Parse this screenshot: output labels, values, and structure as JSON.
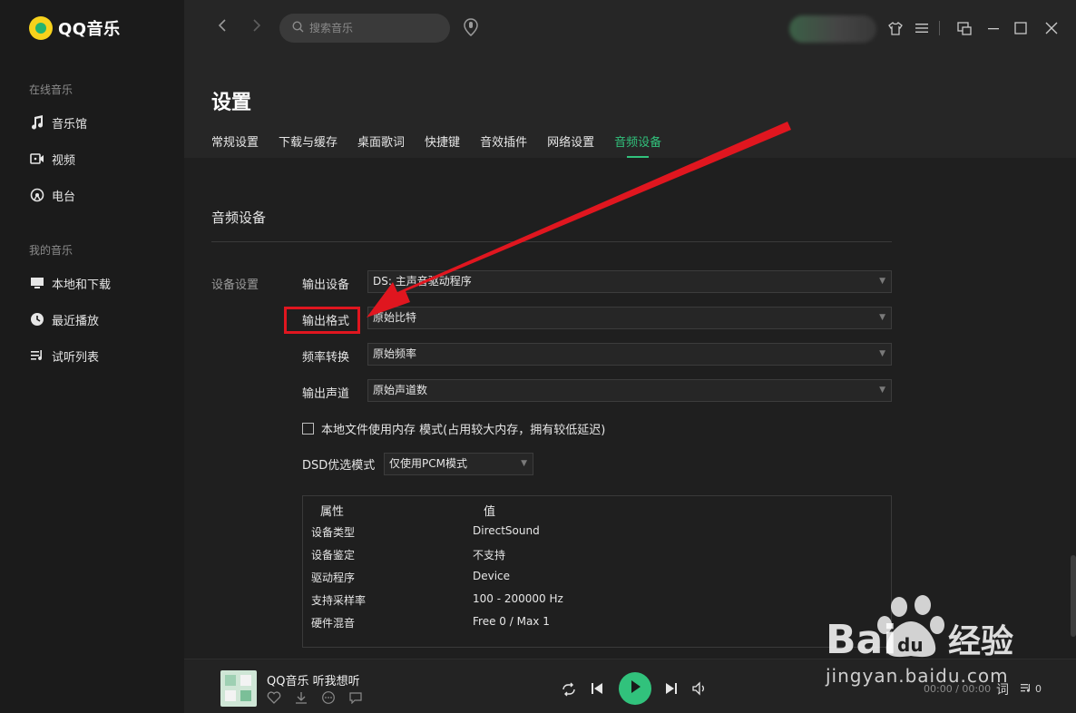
{
  "app": {
    "name": "QQ音乐"
  },
  "sidebar": {
    "group_online": "在线音乐",
    "online_items": [
      {
        "label": "音乐馆",
        "icon": "music-note-icon"
      },
      {
        "label": "视频",
        "icon": "video-icon"
      },
      {
        "label": "电台",
        "icon": "radio-icon"
      }
    ],
    "group_mine": "我的音乐",
    "mine_items": [
      {
        "label": "本地和下载",
        "icon": "computer-icon"
      },
      {
        "label": "最近播放",
        "icon": "clock-icon"
      },
      {
        "label": "试听列表",
        "icon": "playlist-icon"
      }
    ]
  },
  "topbar": {
    "search_placeholder": "搜索音乐"
  },
  "settings": {
    "title": "设置",
    "tabs": [
      "常规设置",
      "下载与缓存",
      "桌面歌词",
      "快捷键",
      "音效插件",
      "网络设置",
      "音频设备"
    ],
    "active_tab": "音频设备",
    "section_title": "音频设备",
    "group_label": "设备设置",
    "rows": [
      {
        "label": "输出设备",
        "value": "DS: 主声音驱动程序"
      },
      {
        "label": "输出格式",
        "value": "原始比特"
      },
      {
        "label": "频率转换",
        "value": "原始频率"
      },
      {
        "label": "输出声道",
        "value": "原始声道数"
      }
    ],
    "memory_mode_label": "本地文件使用内存 模式(占用较大内存，拥有较低延迟)",
    "memory_mode_checked": false,
    "dsd_label": "DSD优选模式",
    "dsd_value": "仅使用PCM模式",
    "properties": {
      "header_attr": "属性",
      "header_value": "值",
      "rows": [
        {
          "attr": "设备类型",
          "value": "DirectSound"
        },
        {
          "attr": "设备鉴定",
          "value": "不支持"
        },
        {
          "attr": "驱动程序",
          "value": "Device"
        },
        {
          "attr": "支持采样率",
          "value": "100 - 200000 Hz"
        },
        {
          "attr": "硬件混音",
          "value": "Free 0 / Max 1"
        }
      ]
    }
  },
  "player": {
    "song": "QQ音乐 听我想听",
    "time": "00:00 / 00:00",
    "lyric_label": "词",
    "queue_count": "0",
    "accent": "#31c27c"
  },
  "annotation": {
    "color": "#e0161f"
  },
  "watermark": {
    "brand": "Baidu经验",
    "url": "jingyan.baidu.com"
  }
}
